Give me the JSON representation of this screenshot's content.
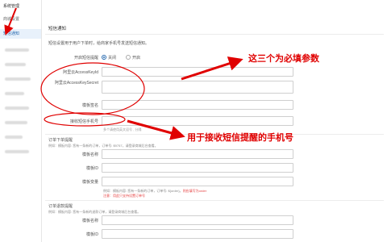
{
  "sidebar": {
    "title": "系统管理",
    "items": [
      {
        "label": "商城设置",
        "active": false
      },
      {
        "label": "短信通知",
        "active": true
      }
    ]
  },
  "main": {
    "page_title": "短信通知",
    "description": "短信设置用于用户下单时，给商家手机号发送短信通知。",
    "switch_row": {
      "label": "开启短信提醒",
      "options": [
        {
          "label": "关闭",
          "checked": true
        },
        {
          "label": "开启",
          "checked": false
        }
      ]
    },
    "fields": [
      {
        "label": "阿里云AccessKeyId",
        "value": ""
      },
      {
        "label": "阿里云AccessKeySecret",
        "value": ""
      },
      {
        "label": "模板签名",
        "value": ""
      },
      {
        "label": "接收短信手机号",
        "value": ""
      }
    ],
    "phone_hint": "多个请使用英文逗号 , 分隔",
    "order_section": {
      "title": "订单下单提醒",
      "example": "例如：模板内容: 您有一条新的订单，订单号: $9757，请登录商城后台查看。",
      "fields": [
        {
          "label": "模板名称",
          "value": ""
        },
        {
          "label": "模板ID",
          "value": ""
        },
        {
          "label": "模板变量",
          "value": ""
        }
      ],
      "var_note_prefix": "例如：模板内容: 您有一条新的订单，订单号: ${order}，",
      "var_note_warn": "则应填写为order",
      "var_note_red": "注意：用此只支持设置订单号"
    },
    "refund_section": {
      "title": "订单退款提醒",
      "example": "例如：模板内容: 您有一条新的退款订单，请登录商城后台查看。",
      "fields": [
        {
          "label": "模板名称",
          "value": ""
        },
        {
          "label": "模板ID",
          "value": ""
        }
      ]
    }
  },
  "annotations": {
    "required_text": "这三个为必填参数",
    "phone_text": "用于接收短信提醒的手机号",
    "color": "#e00000"
  }
}
